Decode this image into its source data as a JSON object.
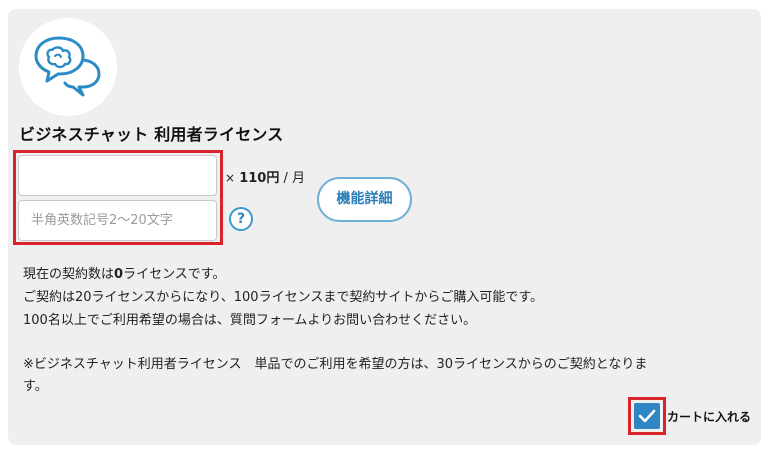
{
  "product": {
    "title": "ビジネスチャット 利用者ライセンス",
    "logo_icon": "chat-bubbles-icon"
  },
  "form": {
    "quantity_value": "",
    "code_placeholder": "半角英数記号2～20文字",
    "code_value": ""
  },
  "price": {
    "times": "×",
    "amount": "110円",
    "unit": " / 月"
  },
  "help": {
    "icon": "question-icon",
    "label": "?"
  },
  "feature_button": {
    "label": "機能詳細"
  },
  "info": {
    "line1_prefix": "現在の契約数は",
    "line1_count": "0",
    "line1_suffix": "ライセンスです。",
    "line2": "ご契約は20ライセンスからになり、100ライセンスまで契約サイトからご購入可能です。",
    "line3": "100名以上でご利用希望の場合は、質問フォームよりお問い合わせください。",
    "note_line1": "※ビジネスチャット利用者ライセンス　単品でのご利用を希望の方は、30ライセンスからのご契約となりま",
    "note_line2": "す。"
  },
  "cart": {
    "label": "カートに入れる",
    "checked": true,
    "icon": "checkmark-icon"
  },
  "colors": {
    "accent": "#2f86c4",
    "highlight_border": "#d9232a",
    "card_background": "#efefef"
  }
}
